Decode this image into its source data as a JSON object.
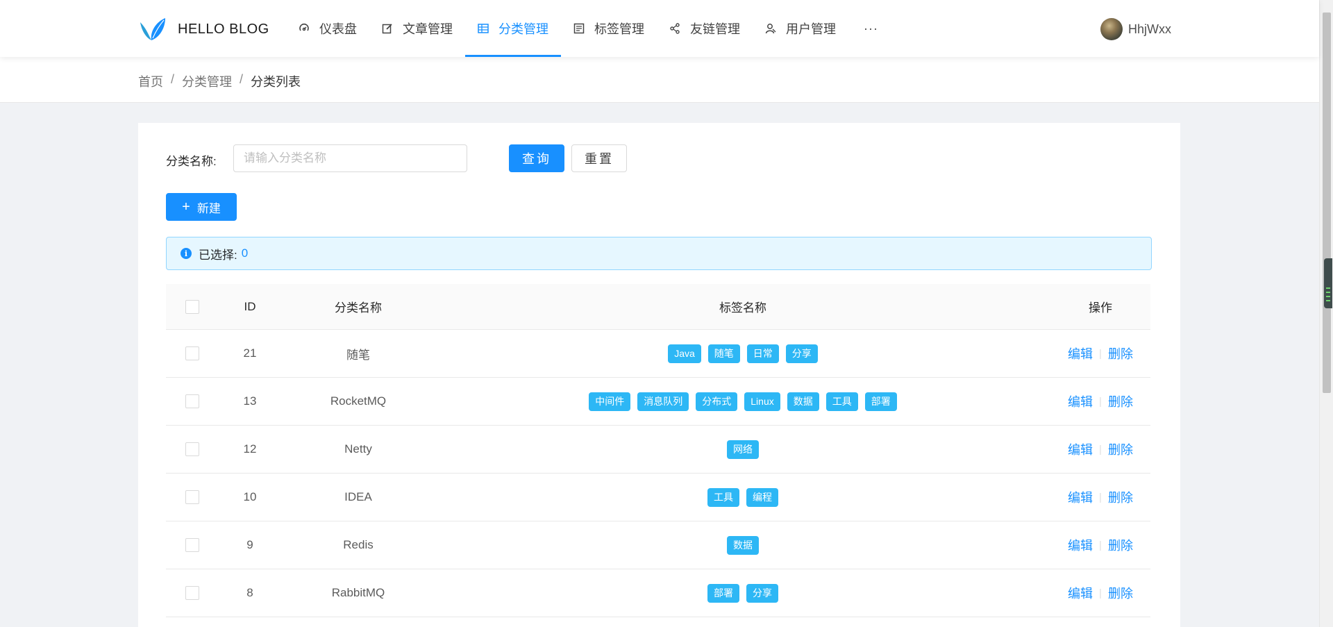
{
  "header": {
    "logo_text": "HELLO BLOG",
    "nav": [
      {
        "label": "仪表盘",
        "icon": "dashboard-icon"
      },
      {
        "label": "文章管理",
        "icon": "edit-icon"
      },
      {
        "label": "分类管理",
        "icon": "table-icon",
        "active": true
      },
      {
        "label": "标签管理",
        "icon": "profile-icon"
      },
      {
        "label": "友链管理",
        "icon": "share-icon"
      },
      {
        "label": "用户管理",
        "icon": "user-icon"
      }
    ],
    "more_label": "···",
    "user_name": "HhjWxx"
  },
  "breadcrumb": [
    "首页",
    "分类管理",
    "分类列表"
  ],
  "breadcrumb_separator": "/",
  "search": {
    "label": "分类名称:",
    "placeholder": "请输入分类名称",
    "value": ""
  },
  "buttons": {
    "query": "查询",
    "reset": "重置",
    "new": "新建"
  },
  "alert": {
    "label": "已选择:",
    "count": "0"
  },
  "table": {
    "columns": [
      "ID",
      "分类名称",
      "标签名称",
      "操作"
    ],
    "rows": [
      {
        "id": "21",
        "name": "随笔",
        "tags": [
          "Java",
          "随笔",
          "日常",
          "分享"
        ]
      },
      {
        "id": "13",
        "name": "RocketMQ",
        "tags": [
          "中间件",
          "消息队列",
          "分布式",
          "Linux",
          "数据",
          "工具",
          "部署"
        ]
      },
      {
        "id": "12",
        "name": "Netty",
        "tags": [
          "网络"
        ]
      },
      {
        "id": "10",
        "name": "IDEA",
        "tags": [
          "工具",
          "编程"
        ]
      },
      {
        "id": "9",
        "name": "Redis",
        "tags": [
          "数据"
        ]
      },
      {
        "id": "8",
        "name": "RabbitMQ",
        "tags": [
          "部署",
          "分享"
        ]
      }
    ],
    "op_edit": "编辑",
    "op_delete": "删除",
    "op_separator": "|"
  },
  "colors": {
    "primary": "#1890ff",
    "tag": "#2db7f5",
    "alert_bg": "#e6f7ff"
  }
}
